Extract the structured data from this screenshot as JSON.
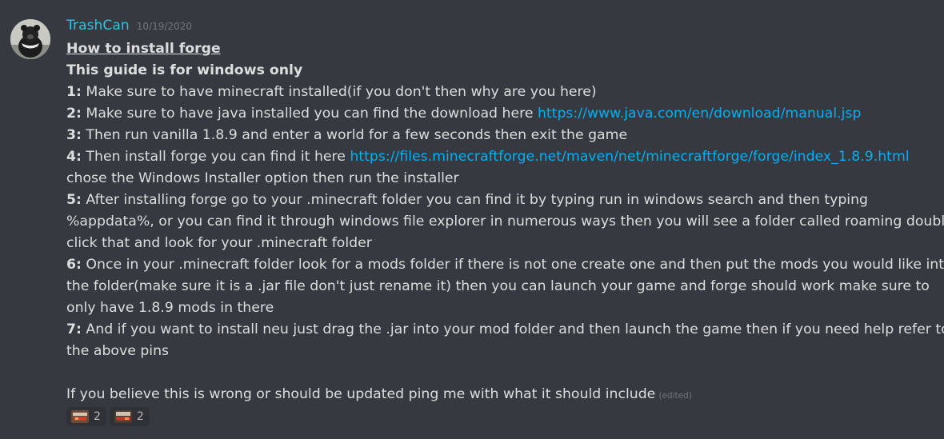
{
  "message": {
    "author": "TrashCan",
    "timestamp": "10/19/2020",
    "title": "How to install forge",
    "subtitle": "This guide is for windows only",
    "steps": [
      {
        "num": "1:",
        "text": " Make sure to have minecraft installed(if you don't then why are you here)"
      },
      {
        "num": "2:",
        "text": " Make sure to have java installed you can find the download here ",
        "link": "https://www.java.com/en/download/manual.jsp"
      },
      {
        "num": "3:",
        "text": " Then run vanilla 1.8.9 and enter a world for a few seconds then exit the game"
      },
      {
        "num": "4:",
        "text": " Then install forge you can find it here ",
        "link": "https://files.minecraftforge.net/maven/net/minecraftforge/forge/index_1.8.9.html",
        "continuation": "chose the Windows Installer option then run the installer"
      },
      {
        "num": "5:",
        "text": " After installing forge go to your .minecraft folder you can find it by typing run in windows search and then typing",
        "continuation": "%appdata%, or you can find it through windows file explorer in numerous ways then you will see a folder called roaming double",
        "continuation2": "click that and look for your .minecraft folder"
      },
      {
        "num": "6:",
        "text": " Once in your .minecraft folder look for a mods folder if there is not one create one and then put the mods you would like into",
        "continuation": "the folder(make sure it is a .jar file don't just rename it) then you can launch your game and forge should work make sure to",
        "continuation2": "only have 1.8.9 mods in there"
      },
      {
        "num": "7:",
        "text": " And if you want to install neu just drag the .jar into your mod folder and then launch the game then if you need help refer to",
        "continuation": "the above pins"
      }
    ],
    "footer": "If you believe this is wrong or should be updated ping me with what it should include",
    "edited": "(edited)"
  },
  "reactions": [
    {
      "emoji": "custom-emoji-1",
      "count": "2"
    },
    {
      "emoji": "custom-emoji-2",
      "count": "2"
    }
  ],
  "colors": {
    "background": "#36393f",
    "username": "#2dc3e0",
    "link": "#00aff4",
    "text": "#dcddde",
    "muted": "#72767d"
  }
}
